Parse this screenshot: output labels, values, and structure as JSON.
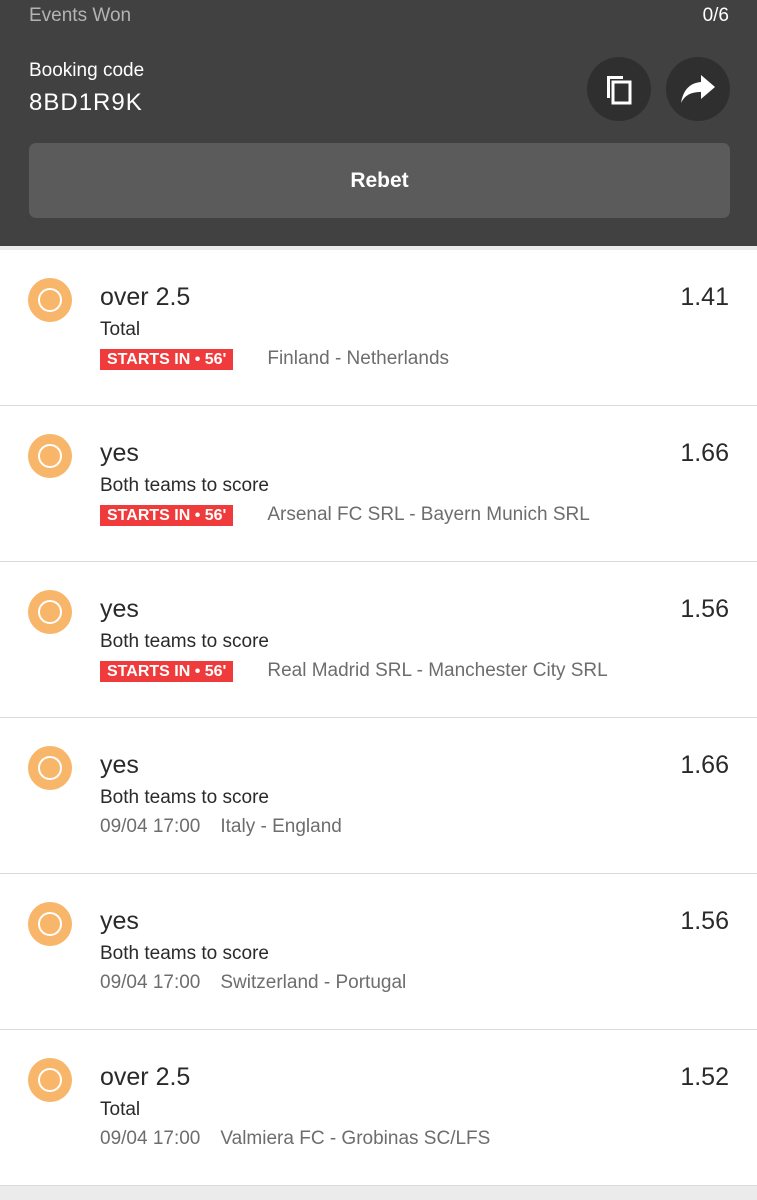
{
  "header": {
    "events_won_label": "Events Won",
    "events_won_value": "0/6",
    "booking_label": "Booking code",
    "booking_code": "8BD1R9K",
    "copy_icon": "copy-icon",
    "share_icon": "share-icon",
    "rebet_label": "Rebet"
  },
  "colors": {
    "header_bg": "#414141",
    "pending": "#f8b66a",
    "starts_badge": "#ef3b3b"
  },
  "bets": [
    {
      "pick": "over 2.5",
      "odds": "1.41",
      "market": "Total",
      "badge": "STARTS IN • 56'",
      "kickoff": "",
      "match": "Finland - Netherlands"
    },
    {
      "pick": "yes",
      "odds": "1.66",
      "market": "Both teams to score",
      "badge": "STARTS IN • 56'",
      "kickoff": "",
      "match": "Arsenal FC SRL - Bayern Munich SRL"
    },
    {
      "pick": "yes",
      "odds": "1.56",
      "market": "Both teams to score",
      "badge": "STARTS IN • 56'",
      "kickoff": "",
      "match": "Real Madrid SRL - Manchester City SRL"
    },
    {
      "pick": "yes",
      "odds": "1.66",
      "market": "Both teams to score",
      "badge": "",
      "kickoff": "09/04 17:00",
      "match": "Italy - England"
    },
    {
      "pick": "yes",
      "odds": "1.56",
      "market": "Both teams to score",
      "badge": "",
      "kickoff": "09/04 17:00",
      "match": "Switzerland - Portugal"
    },
    {
      "pick": "over 2.5",
      "odds": "1.52",
      "market": "Total",
      "badge": "",
      "kickoff": "09/04 17:00",
      "match": "Valmiera FC - Grobinas SC/LFS"
    }
  ]
}
